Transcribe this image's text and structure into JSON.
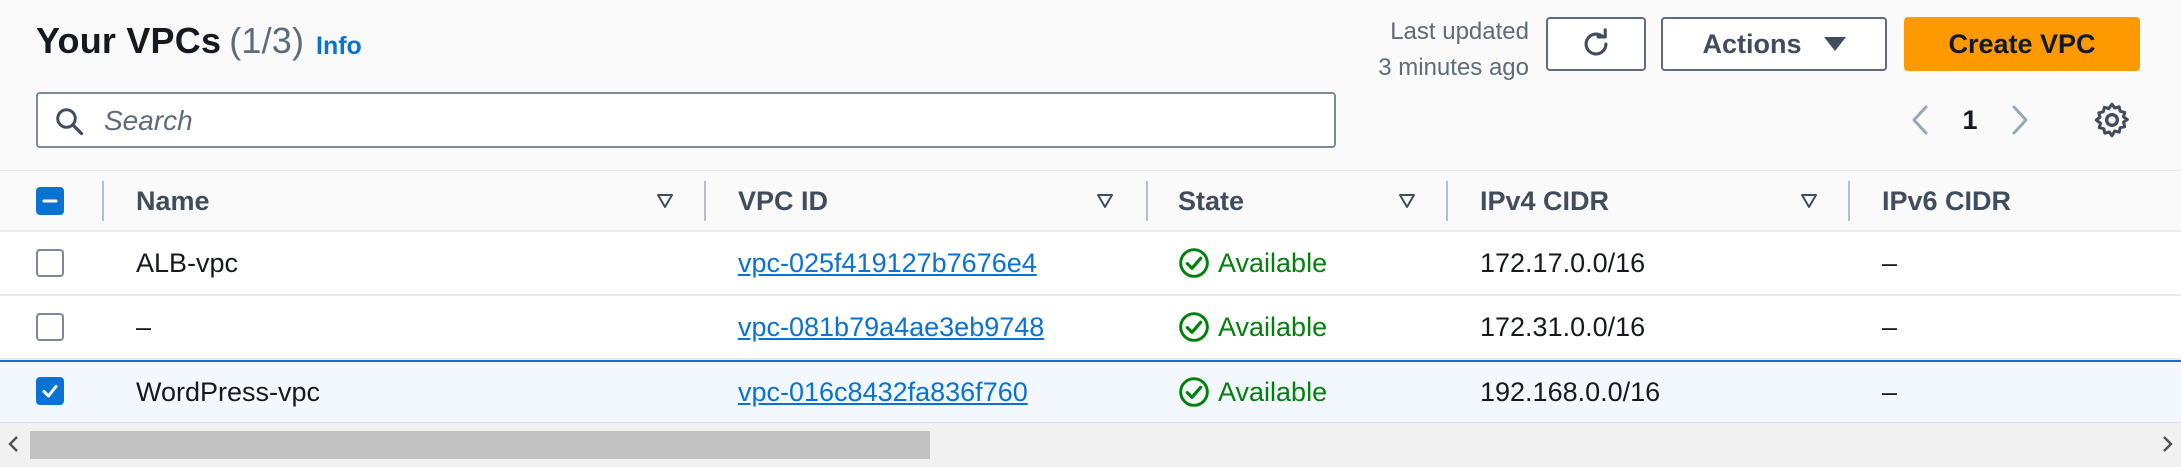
{
  "header": {
    "title": "Your VPCs",
    "count": "(1/3)",
    "info_label": "Info",
    "last_updated_line1": "Last updated",
    "last_updated_line2": "3 minutes ago",
    "actions_label": "Actions",
    "create_label": "Create VPC"
  },
  "search": {
    "placeholder": "Search",
    "value": ""
  },
  "pagination": {
    "current_page": "1"
  },
  "columns": [
    "Name",
    "VPC ID",
    "State",
    "IPv4 CIDR",
    "IPv6 CIDR"
  ],
  "rows": [
    {
      "name": "ALB-vpc",
      "vpc_id": "vpc-025f419127b7676e4",
      "state": "Available",
      "ipv4": "172.17.0.0/16",
      "ipv6": "–",
      "selected": false
    },
    {
      "name": "–",
      "vpc_id": "vpc-081b79a4ae3eb9748",
      "state": "Available",
      "ipv4": "172.31.0.0/16",
      "ipv6": "–",
      "selected": false
    },
    {
      "name": "WordPress-vpc",
      "vpc_id": "vpc-016c8432fa836f760",
      "state": "Available",
      "ipv4": "192.168.0.0/16",
      "ipv6": "–",
      "selected": true
    }
  ],
  "colors": {
    "accent": "#0972d3",
    "primary_button": "#ff9900",
    "status_ok": "#037f0c"
  },
  "icons": [
    "refresh-icon",
    "dropdown-triangle-icon",
    "search-icon",
    "chevron-left-icon",
    "chevron-right-icon",
    "gear-icon",
    "sort-icon",
    "status-ok-icon",
    "checkbox-check-icon",
    "checkbox-indeterminate-icon"
  ]
}
